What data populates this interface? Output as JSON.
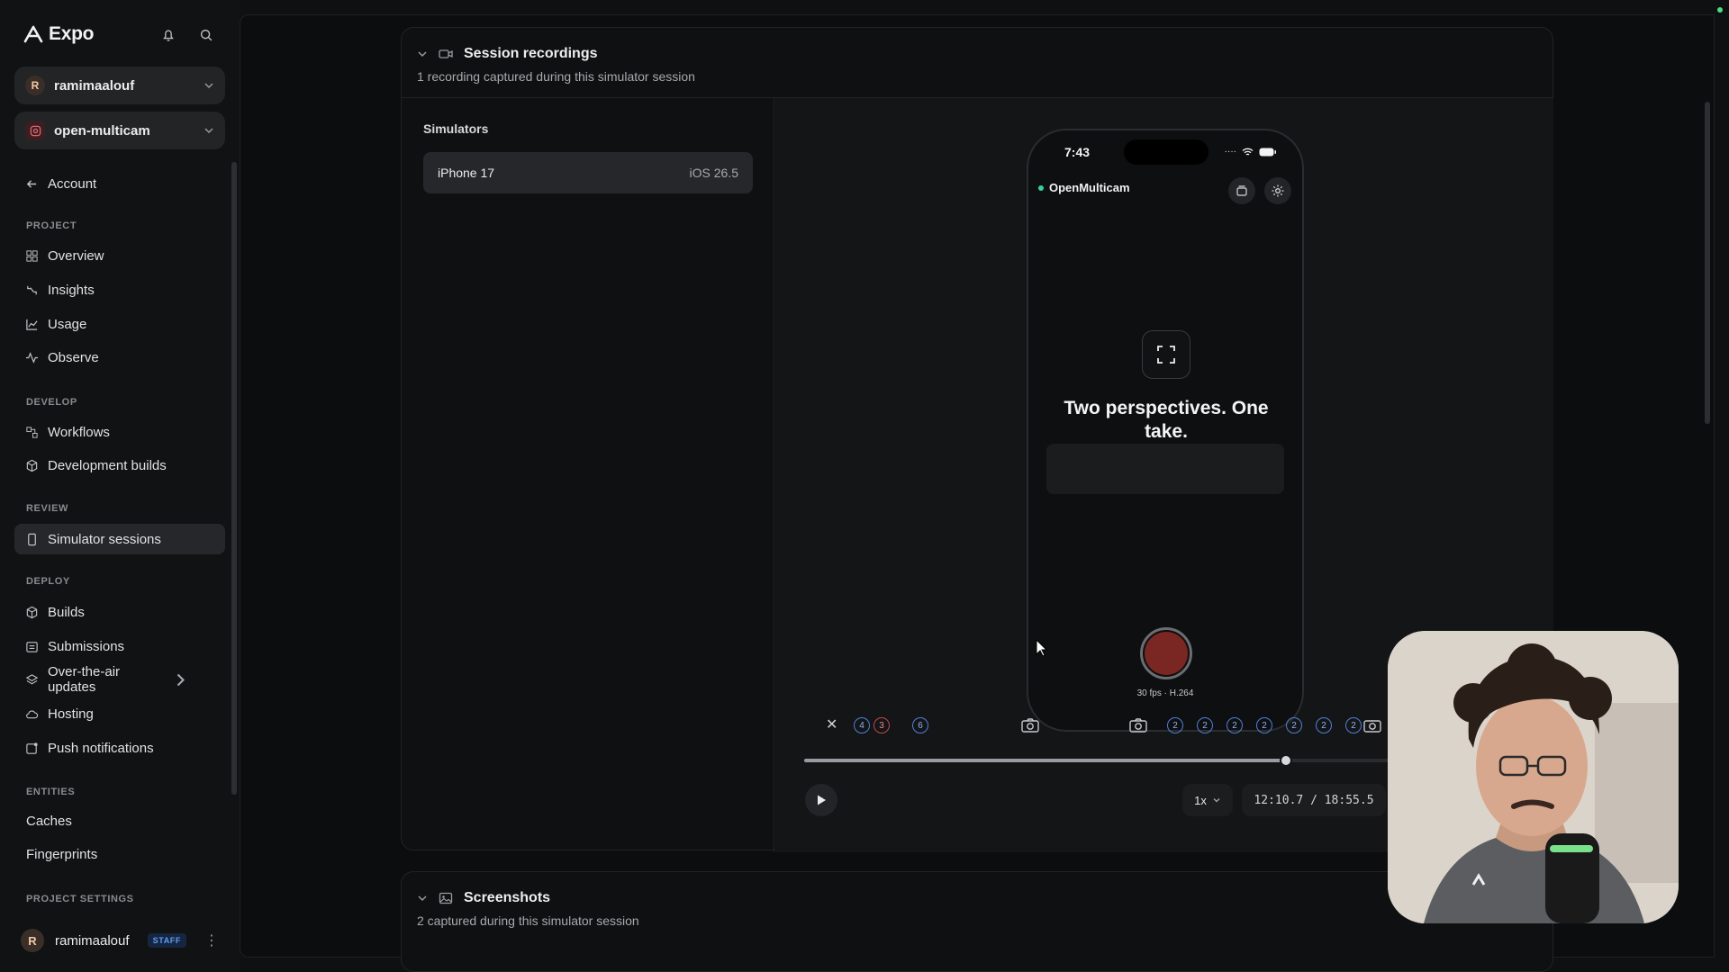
{
  "brand": {
    "name": "Expo"
  },
  "selectors": {
    "account": "ramimaalouf",
    "account_initial": "R",
    "project": "open-multicam"
  },
  "nav": {
    "back": "Account",
    "sections": {
      "project": "PROJECT",
      "develop": "DEVELOP",
      "review": "REVIEW",
      "deploy": "DEPLOY",
      "entities": "ENTITIES",
      "project_settings": "PROJECT SETTINGS"
    },
    "items": {
      "overview": "Overview",
      "insights": "Insights",
      "usage": "Usage",
      "observe": "Observe",
      "workflows": "Workflows",
      "development_builds": "Development builds",
      "simulator_sessions": "Simulator sessions",
      "builds": "Builds",
      "submissions": "Submissions",
      "ota_updates": "Over-the-air updates",
      "hosting": "Hosting",
      "push_notifications": "Push notifications",
      "caches": "Caches",
      "fingerprints": "Fingerprints"
    },
    "active": "simulator_sessions"
  },
  "footer": {
    "user": "ramimaalouf",
    "initial": "R",
    "badge": "STAFF"
  },
  "recordings": {
    "title": "Session recordings",
    "subtitle": "1 recording captured during this simulator session",
    "simulators_label": "Simulators",
    "simulator": {
      "device": "iPhone 17",
      "os": "iOS 26.5"
    }
  },
  "phone": {
    "time": "7:43",
    "app_name": "OpenMulticam",
    "headline": "Two perspectives. One take.",
    "fps": "30 fps · H.264"
  },
  "player": {
    "speed": "1x",
    "current": "12:10.7",
    "separator": "/",
    "duration": "18:55.5",
    "progress": 0.643,
    "markers": [
      {
        "label": "4",
        "color": "blue"
      },
      {
        "label": "3",
        "color": "red"
      },
      {
        "label": "6",
        "color": "blue"
      },
      {
        "label": "2",
        "color": "blue"
      },
      {
        "label": "2",
        "color": "blue"
      },
      {
        "label": "2",
        "color": "blue"
      },
      {
        "label": "2",
        "color": "blue"
      },
      {
        "label": "2",
        "color": "blue"
      },
      {
        "label": "2",
        "color": "blue"
      },
      {
        "label": "2",
        "color": "blue"
      }
    ]
  },
  "screenshots": {
    "title": "Screenshots",
    "subtitle": "2 captured during this simulator session"
  },
  "colors": {
    "marker_blue": "#4f7fd8",
    "marker_red": "#c0474b",
    "record": "#7a2622",
    "staff_badge": "#5d9cf5"
  }
}
